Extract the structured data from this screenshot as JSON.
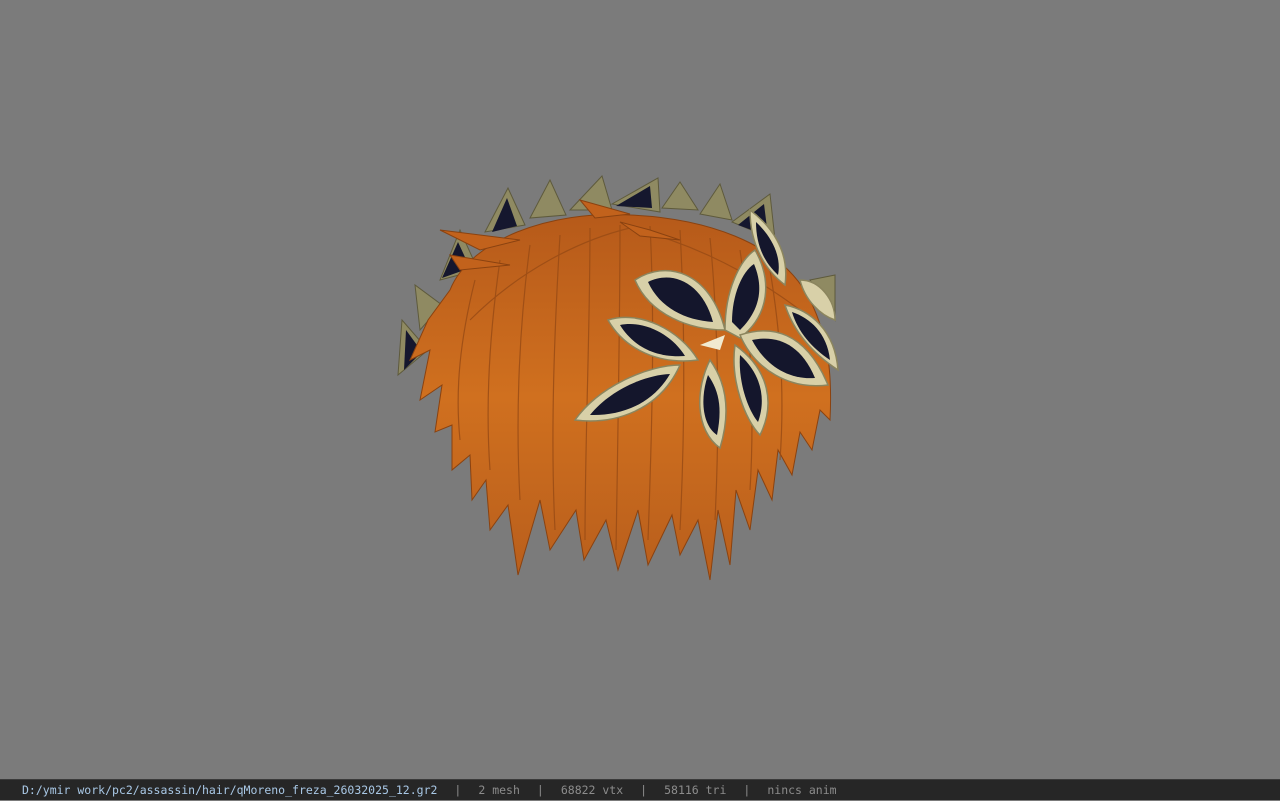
{
  "viewport": {
    "background_color": "#7b7b7b",
    "model": {
      "hair_color": "#c8661f",
      "leaf_rim_color": "#d8d0a8",
      "leaf_inner_color": "#15172e"
    }
  },
  "statusbar": {
    "file_path": "D:/ymir work/pc2/assassin/hair/qMoreno_freza_26032025_12.gr2",
    "separator": "|",
    "mesh_count": "2 mesh",
    "vertex_count": "68822 vtx",
    "triangle_count": "58116 tri",
    "anim_status": "nincs anim"
  }
}
